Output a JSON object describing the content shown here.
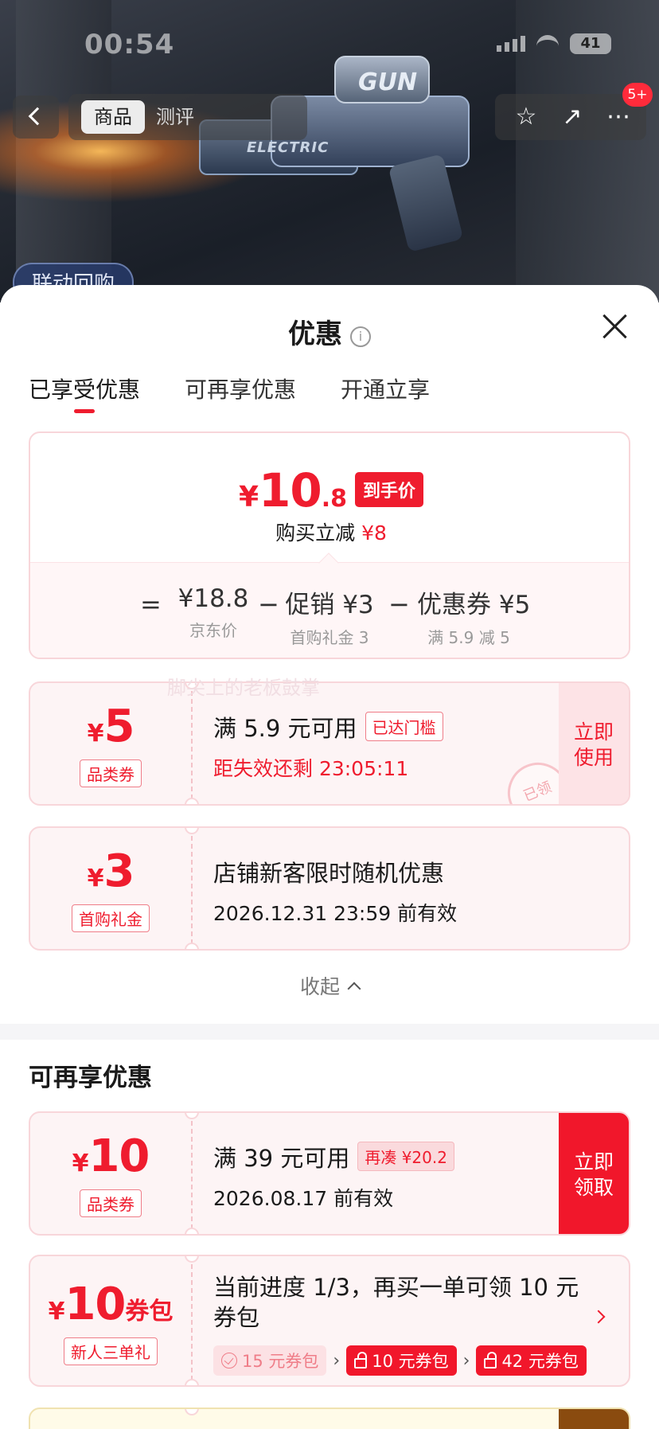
{
  "status_bar": {
    "time": "00:54",
    "battery": "41"
  },
  "nav": {
    "tab_active": "商品",
    "tab_inactive": "测评",
    "badge": "5+"
  },
  "product_image": {
    "brand": "GUN",
    "label": "ELECTRIC"
  },
  "live_tag": "联动回购",
  "sheet": {
    "title": "优惠",
    "tabs": [
      "已享受优惠",
      "可再享优惠",
      "开通立享"
    ]
  },
  "summary": {
    "currency": "¥",
    "price_int": "10",
    "price_dec": ".8",
    "price_tag": "到手价",
    "save_label": "购买立减",
    "save_amount": "¥8",
    "eq": "=",
    "minus": "−",
    "items": [
      {
        "value": "¥18.8",
        "sub": "京东价"
      },
      {
        "value": "促销 ¥3",
        "sub": "首购礼金 3"
      },
      {
        "value": "优惠券 ¥5",
        "sub": "满 5.9 减 5"
      }
    ]
  },
  "coupons_applied": [
    {
      "currency": "¥",
      "amount": "5",
      "kind": "品类券",
      "title": "满 5.9 元可用",
      "pill": "已达门槛",
      "sub": "距失效还剩 23:05:11",
      "action": "立即使用",
      "stamp": "已领"
    },
    {
      "currency": "¥",
      "amount": "3",
      "kind": "首购礼金",
      "title": "店铺新客限时随机优惠",
      "sub": "2026.12.31 23:59 前有效"
    }
  ],
  "watermark": "脚尖上的老板鼓掌",
  "collapse_label": "收起",
  "more_section": {
    "title": "可再享优惠",
    "coupon": {
      "currency": "¥",
      "amount": "10",
      "kind": "品类券",
      "title": "满 39 元可用",
      "pill": "再凑 ¥20.2",
      "sub": "2026.08.17 前有效",
      "action": "立即领取"
    },
    "package": {
      "currency": "¥",
      "amount": "10",
      "suffix": "券包",
      "kind": "新人三单礼",
      "text": "当前进度 1/3，再买一单可领 10 元券包",
      "steps": [
        "15 元券包",
        "10 元券包",
        "42 元券包"
      ],
      "arrow": "›"
    }
  },
  "colors": {
    "accent": "#ef1c2e",
    "coupon_bg": "#fdf4f5",
    "border": "#f8d6da"
  }
}
